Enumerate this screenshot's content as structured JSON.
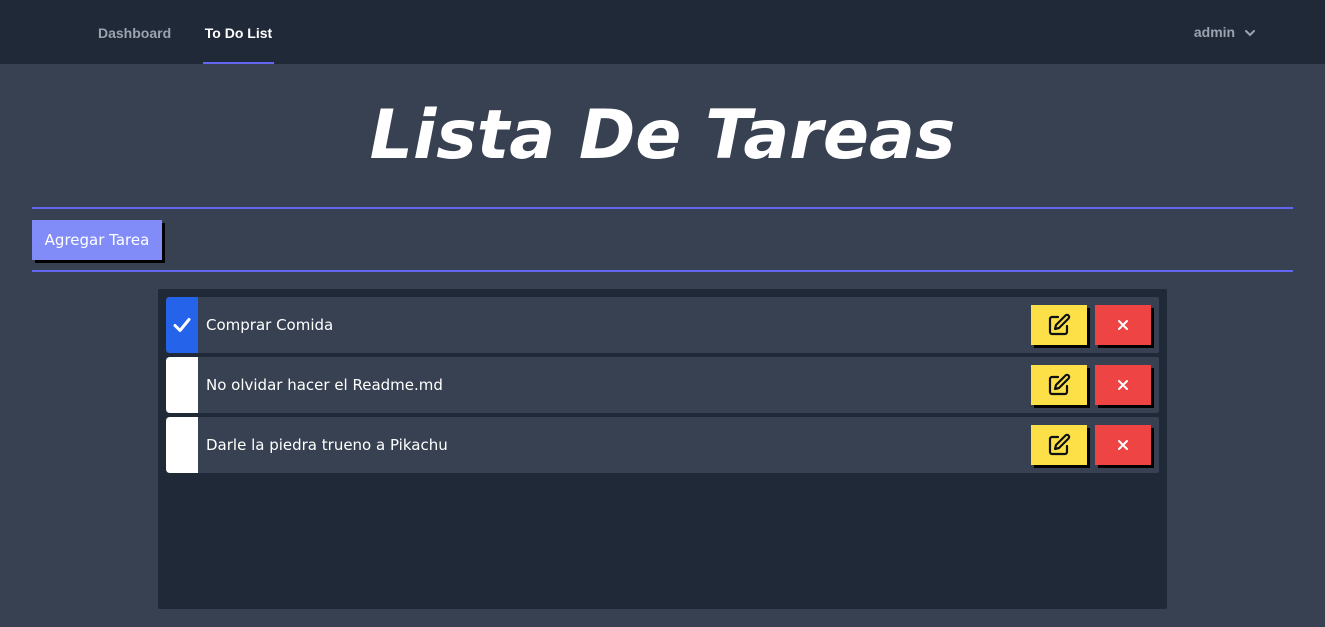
{
  "nav": {
    "items": [
      {
        "label": "Dashboard",
        "active": false
      },
      {
        "label": "To Do List",
        "active": true
      }
    ],
    "user": {
      "label": "admin",
      "icon": "chevron-down-icon"
    }
  },
  "page": {
    "title": "Lista De Tareas",
    "add_button_label": "Agregar Tarea"
  },
  "tasks": [
    {
      "text": "Comprar Comida",
      "completed": true
    },
    {
      "text": "No olvidar hacer el Readme.md",
      "completed": false
    },
    {
      "text": "Darle la piedra trueno a Pikachu",
      "completed": false
    }
  ],
  "colors": {
    "accent": "#6366f1",
    "add_button": "#818cf8",
    "edit_button": "#fde047",
    "delete_button": "#ef4444",
    "checked": "#2563eb"
  }
}
